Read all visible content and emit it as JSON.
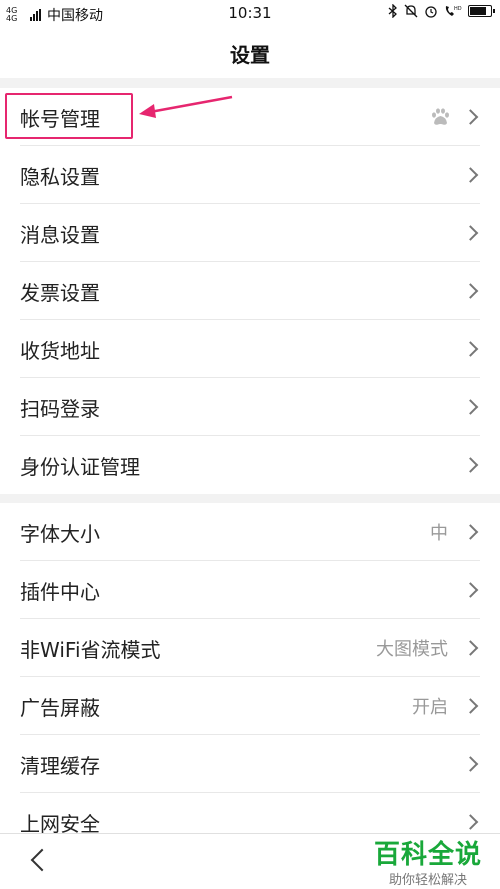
{
  "status_bar": {
    "network": "4G 4G",
    "carrier": "中国移动",
    "time": "10:31",
    "battery_level": 0.85
  },
  "header": {
    "title": "设置"
  },
  "group1": [
    {
      "label": "帐号管理",
      "value": "",
      "icon": "paw-icon"
    },
    {
      "label": "隐私设置",
      "value": ""
    },
    {
      "label": "消息设置",
      "value": ""
    },
    {
      "label": "发票设置",
      "value": ""
    },
    {
      "label": "收货地址",
      "value": ""
    },
    {
      "label": "扫码登录",
      "value": ""
    },
    {
      "label": "身份认证管理",
      "value": ""
    }
  ],
  "group2": [
    {
      "label": "字体大小",
      "value": "中"
    },
    {
      "label": "插件中心",
      "value": ""
    },
    {
      "label": "非WiFi省流模式",
      "value": "大图模式"
    },
    {
      "label": "广告屏蔽",
      "value": "开启"
    },
    {
      "label": "清理缓存",
      "value": ""
    },
    {
      "label": "上网安全",
      "value": ""
    }
  ],
  "watermark": {
    "title": "百科全说",
    "subtitle": "助你轻松解决"
  },
  "colors": {
    "highlight": "#e6266f",
    "watermark": "#19a83a"
  }
}
